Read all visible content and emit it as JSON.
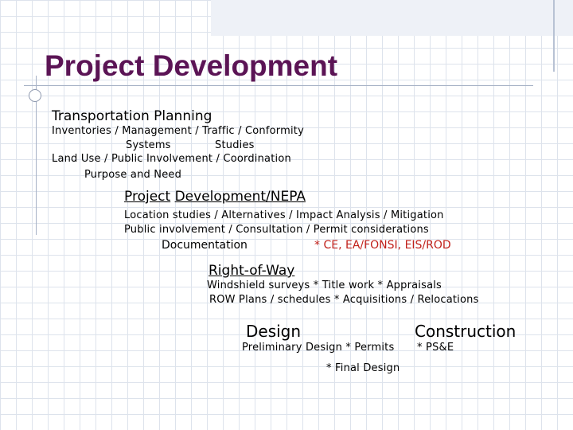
{
  "title": "Project Development",
  "colors": {
    "title": "#5b1455",
    "emphasis": "#c0201a"
  },
  "planning": {
    "heading": "Transportation Planning",
    "line1": "Inventories / Management  / Traffic   / Conformity",
    "line2a": "Systems",
    "line2b": "Studies",
    "line3": "Land Use / Public Involvement / Coordination",
    "line4": "Purpose and Need"
  },
  "nepa": {
    "heading_part1": "Project",
    "heading_part2": "Development/NEPA",
    "line1": "Location studies / Alternatives / Impact Analysis / Mitigation",
    "line2": "Public involvement / Consultation / Permit considerations",
    "documentation": "Documentation",
    "documents": "* CE, EA/FONSI, EIS/ROD"
  },
  "row": {
    "heading": "Right-of-Way",
    "line1": "Windshield surveys *  Title work *  Appraisals",
    "line2": "ROW Plans / schedules *   Acquisitions / Relocations"
  },
  "design": {
    "heading": "Design",
    "line1": "Preliminary Design  * Permits",
    "line2": "*  Final   Design"
  },
  "construction": {
    "heading": "Construction",
    "line1": "* PS&E"
  }
}
